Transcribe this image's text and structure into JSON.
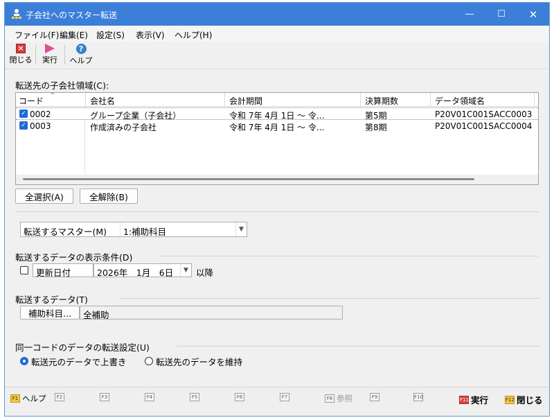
{
  "window": {
    "title": "子会社へのマスター転送",
    "controls": {
      "minimize": "—",
      "maximize": "☐",
      "close": "✕"
    }
  },
  "menu": [
    "ファイル(F)",
    "編集(E)",
    "設定(S)",
    "表示(V)",
    "ヘルプ(H)"
  ],
  "toolbar": {
    "close": "閉じる",
    "run": "実行",
    "help": "ヘルプ"
  },
  "target": {
    "label": "転送先の子会社領域(C):",
    "columns": [
      "コード",
      "会社名",
      "会計期間",
      "決算期数",
      "データ領域名"
    ],
    "rows": [
      {
        "code": "0002",
        "name": "グループ企業（子会社）",
        "period": "令和 7年 4月 1日 ～ 令...",
        "term": "第5期",
        "area": "P20V01C001SACC0003",
        "checked": true
      },
      {
        "code": "0003",
        "name": "作成済みの子会社",
        "period": "令和 7年 4月 1日 ～ 令...",
        "term": "第8期",
        "area": "P20V01C001SACC0004",
        "checked": true
      }
    ],
    "select_all": "全選択(A)",
    "deselect_all": "全解除(B)"
  },
  "master": {
    "label": "転送するマスター(M)",
    "value": "1:補助科目"
  },
  "condition": {
    "label": "転送するデータの表示条件(D)",
    "checkbox": "更新日付",
    "date": "2026年　1月　6日",
    "suffix": "以降"
  },
  "data": {
    "label": "転送するデータ(T)",
    "button": "補助科目...",
    "value": "全補助"
  },
  "same_code": {
    "label": "同一コードのデータの転送設定(U)",
    "option1": "転送元のデータで上書き",
    "option2": "転送先のデータを維持",
    "selected": 1
  },
  "fkeys": {
    "f1": "ヘルプ",
    "f2": "F2",
    "f3": "F3",
    "f4": "F4",
    "f5": "F5",
    "f6": "F6",
    "f7": "F7",
    "f8": "参照",
    "f9": "F9",
    "f10": "F10",
    "f11": "実行",
    "f12": "閉じる"
  }
}
